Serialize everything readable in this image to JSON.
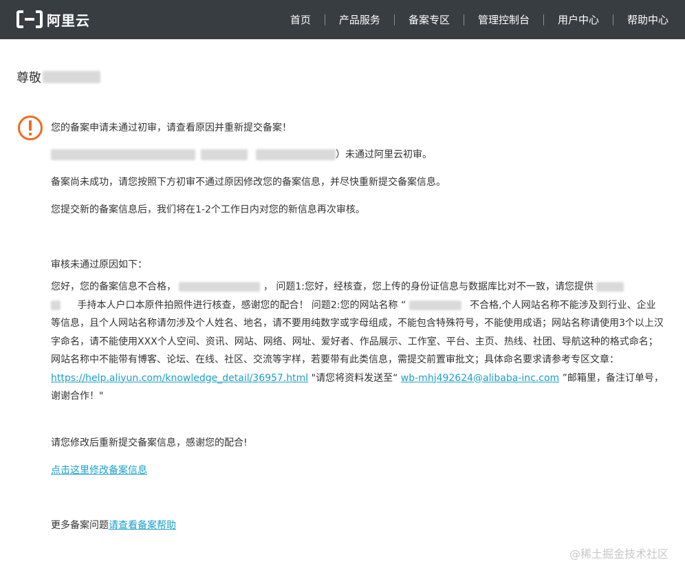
{
  "header": {
    "brand": "阿里云",
    "nav": [
      {
        "label": "首页"
      },
      {
        "label": "产品服务"
      },
      {
        "label": "备案专区"
      },
      {
        "label": "管理控制台"
      },
      {
        "label": "用户中心"
      },
      {
        "label": "帮助中心"
      }
    ]
  },
  "greeting": "尊敬",
  "notice": {
    "title": "您的备案申请未通过初审，请查看原因并重新提交备案！",
    "line2_suffix": "）未通过阿里云初审。",
    "line3": "备案尚未成功，请您按照下方初审不通过原因修改您的备案信息，并尽快重新提交备案信息。",
    "line4": "您提交新的备案信息后，我们将在1-2个工作日内对您的新信息再次审核。"
  },
  "reasons": {
    "heading": "审核未通过原因如下：",
    "p1_a": "您好，您的备案信息不合格，",
    "p1_b": "，  问题1:您好，经核查，您上传的身份证信息与数据库比对不一致，请您提供",
    "p1_c": "手持本人户口本原件拍照件进行核查，感谢您的配合！  问题2:您的网站名称 “",
    "p1_d": "不合格,个人网站名称不能涉及到行业、企业等信息，且个人网站名称请勿涉及个人姓名、地名，请不要用纯数字或字母组成，不能包含特殊符号，不能使用成语；网站名称请使用3个以上汉字命名，请不能使用XXX个人空间、资讯、网站、网络、网址、爱好者、作品展示、工作室、平台、主页、热线、社团、导航这种的格式命名；网站名称中不能带有博客、论坛、在线、社区、交流等字样，若要带有此类信息，需提交前置审批文；具体命名要求请参考专区文章：",
    "link_article": "https://help.aliyun.com/knowledge_detail/36957.html",
    "p1_e": " \"请您将资料发送至“",
    "link_email": "wb-mhj492624@alibaba-inc.com",
    "p1_f": "”邮箱里，备注订单号，谢谢合作！\""
  },
  "resubmit": "请您修改后重新提交备案信息，感谢您的配合!",
  "modify_link": "点击这里修改备案信息",
  "more_help_prefix": "更多备案问题",
  "more_help_link": "请查看备案帮助",
  "watermark": "@稀土掘金技术社区",
  "colors": {
    "topbar": "#383d41",
    "link": "#1aa0c8",
    "warning": "#f06a1e"
  }
}
